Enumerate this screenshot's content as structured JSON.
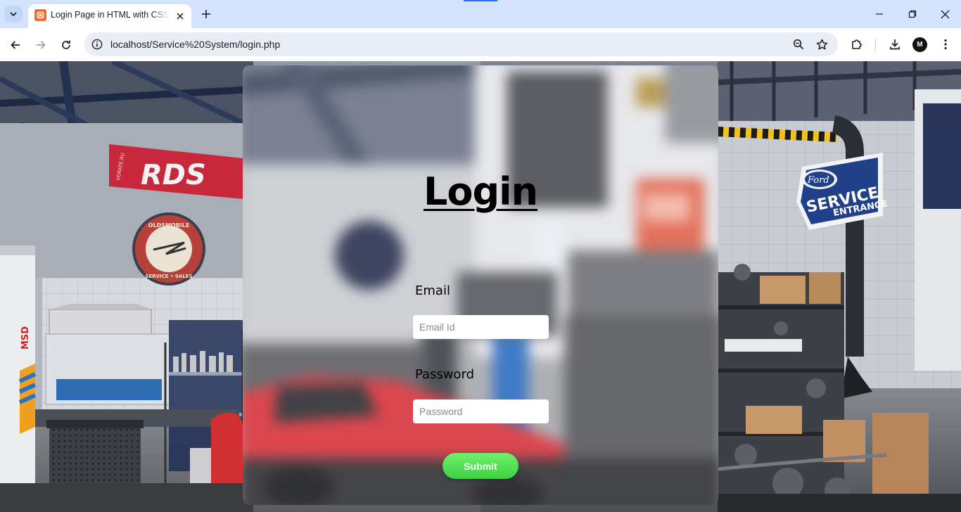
{
  "browser": {
    "tab": {
      "title": "Login Page in HTML with CSS Code",
      "favicon": "xampp-icon"
    },
    "url": "localhost/Service%20System/login.php",
    "profile_initial": "M"
  },
  "login": {
    "title": "Login",
    "email_label": "Email",
    "email_placeholder": "Email Id",
    "password_label": "Password",
    "password_placeholder": "Password",
    "submit_label": "Submit"
  },
  "background_signs": {
    "banner": "RDS",
    "banner_side": "VORATE.RU",
    "round_sign": "OLDSMOBILE",
    "round_sign_bottom": "SERVICE • SALES",
    "ford_sign_logo": "Ford",
    "ford_sign_text": "SERVICE",
    "ford_sign_sub": "ENTRANCE",
    "lift_brand": "MSD"
  },
  "colors": {
    "accent_green": "#4cdc4c",
    "chrome_blue": "#d3e3fd"
  }
}
